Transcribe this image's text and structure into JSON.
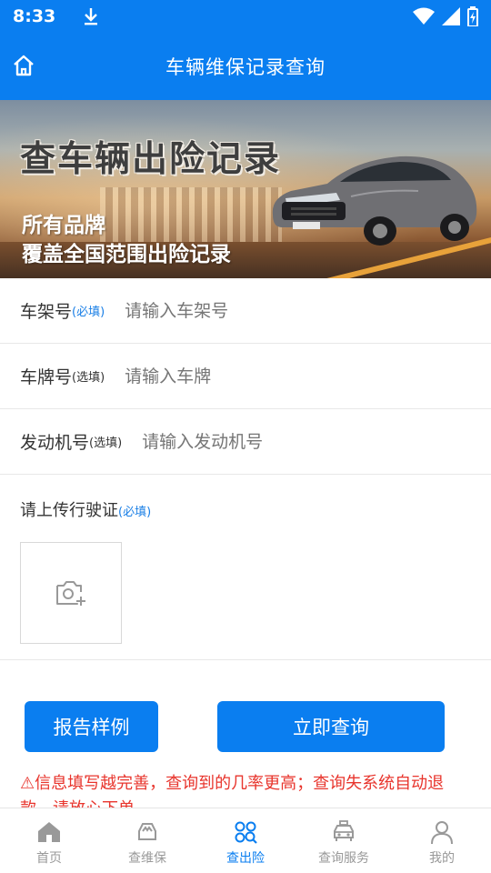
{
  "status_bar": {
    "time": "8:33"
  },
  "header": {
    "title": "车辆维保记录查询"
  },
  "banner": {
    "headline": "查车辆出险记录",
    "line1": "所有品牌",
    "line2": "覆盖全国范围出险记录"
  },
  "form": {
    "vin": {
      "label": "车架号",
      "hint": "(必填)",
      "placeholder": "请输入车架号"
    },
    "plate": {
      "label": "车牌号",
      "hint": "(选填)",
      "placeholder": "请输入车牌"
    },
    "engine": {
      "label": "发动机号",
      "hint": "(选填)",
      "placeholder": "请输入发动机号"
    },
    "license": {
      "label": "请上传行驶证",
      "hint": "(必填)"
    }
  },
  "buttons": {
    "report_sample": "报告样例",
    "query_now": "立即查询"
  },
  "notice": "⚠信息填写越完善，查询到的几率更高；查询失系统自动退款，请放心下单。",
  "tabbar": {
    "items": [
      {
        "label": "首页",
        "icon": "home-icon"
      },
      {
        "label": "查维保",
        "icon": "car-wrench-icon"
      },
      {
        "label": "查出险",
        "icon": "search-grid-icon"
      },
      {
        "label": "查询服务",
        "icon": "taxi-icon"
      },
      {
        "label": "我的",
        "icon": "user-icon"
      }
    ],
    "active_index": 2
  },
  "colors": {
    "primary": "#0a7ef0",
    "warning": "#e8352d",
    "hint_required": "#1a7fe6"
  }
}
